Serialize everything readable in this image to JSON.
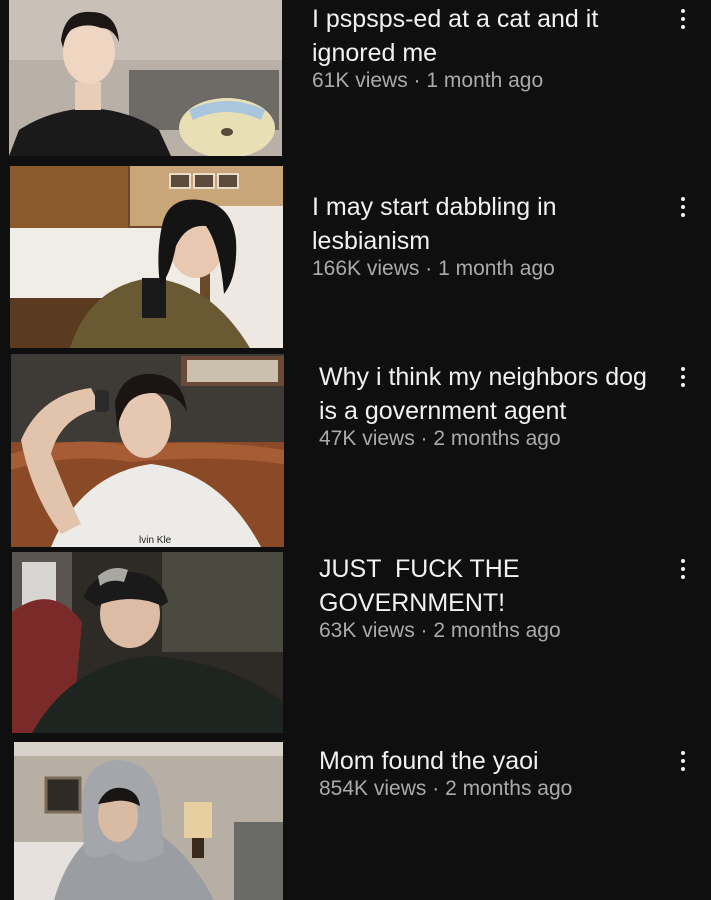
{
  "videos": [
    {
      "title": "I pspsps-ed at a cat and it ignored me",
      "views": "61K views",
      "age": "1 month ago",
      "thumbnail": "person-in-black-shirt-with-plush-toy"
    },
    {
      "title": "I may start dabbling in lesbianism",
      "views": "166K views",
      "age": "1 month ago",
      "thumbnail": "person-in-hotel-room-olive-jacket"
    },
    {
      "title": "Why i think my neighbors dog is a government agent",
      "views": "47K views",
      "age": "2 months ago",
      "thumbnail": "person-on-leather-couch-white-tee",
      "thumbnail_text": "lvin Kle"
    },
    {
      "title": "JUST  FUCK THE GOVERNMENT!",
      "views": "63K views",
      "age": "2 months ago",
      "thumbnail": "person-with-headband-dark-room"
    },
    {
      "title": "Mom found the yaoi",
      "views": "854K views",
      "age": "2 months ago",
      "thumbnail": "person-in-grey-hoodie-room"
    }
  ],
  "separator": " · ",
  "colors": {
    "background": "#0f0f0f",
    "title": "#f1f1f1",
    "meta": "#aaaaaa"
  },
  "icons": {
    "menu": "more-vertical-icon"
  }
}
